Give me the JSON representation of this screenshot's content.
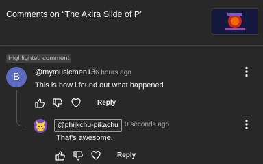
{
  "header": {
    "title": "Comments on “The Akira Slide of P”"
  },
  "highlight_label": "Highlighted comment",
  "comment": {
    "avatar_letter": "B",
    "author": "@mymusicmen13",
    "time": "6 hours ago",
    "text": "This is how i found out what happened",
    "reply_label": "Reply"
  },
  "reply": {
    "author": "@phijkchu-pikachu",
    "time": "0 seconds ago",
    "text": "That's awesome.",
    "reply_label": "Reply"
  },
  "colors": {
    "background": "#282828",
    "avatar": "#5c6bc0",
    "text": "#f1f1f1",
    "secondary": "#aaaaaa"
  },
  "icons": [
    "thumbs-up-icon",
    "thumbs-down-icon",
    "heart-icon",
    "more-vert-icon"
  ]
}
